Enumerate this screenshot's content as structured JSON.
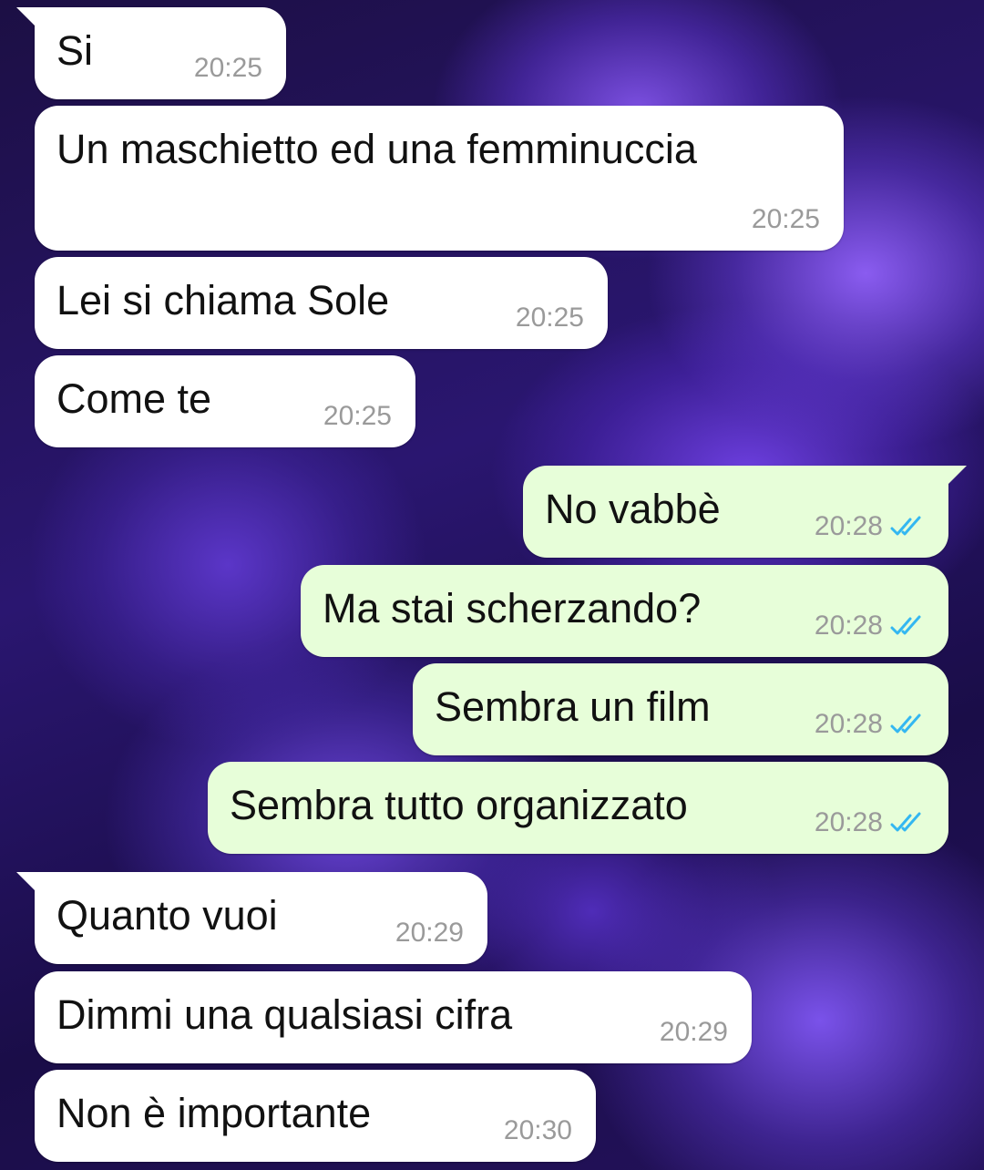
{
  "chat": {
    "messages": [
      {
        "direction": "incoming",
        "text": "Si",
        "time": "20:25"
      },
      {
        "direction": "incoming",
        "text": "Un maschietto ed una femminuccia",
        "time": "20:25"
      },
      {
        "direction": "incoming",
        "text": "Lei si chiama Sole",
        "time": "20:25"
      },
      {
        "direction": "incoming",
        "text": "Come te",
        "time": "20:25"
      },
      {
        "direction": "outgoing",
        "text": "No vabbè",
        "time": "20:28",
        "status": "read"
      },
      {
        "direction": "outgoing",
        "text": "Ma stai scherzando?",
        "time": "20:28",
        "status": "read"
      },
      {
        "direction": "outgoing",
        "text": "Sembra un film",
        "time": "20:28",
        "status": "read"
      },
      {
        "direction": "outgoing",
        "text": "Sembra tutto organizzato",
        "time": "20:28",
        "status": "read"
      },
      {
        "direction": "incoming",
        "text": "Quanto vuoi",
        "time": "20:29"
      },
      {
        "direction": "incoming",
        "text": "Dimmi una qualsiasi cifra",
        "time": "20:29"
      },
      {
        "direction": "incoming",
        "text": "Non è importante",
        "time": "20:30"
      }
    ]
  },
  "colors": {
    "incoming_bubble": "#ffffff",
    "outgoing_bubble": "#e7fed9",
    "read_ticks": "#34b7f1",
    "timestamp": "#9a9a9a"
  },
  "icons": {
    "read_status": "double-check-icon"
  }
}
